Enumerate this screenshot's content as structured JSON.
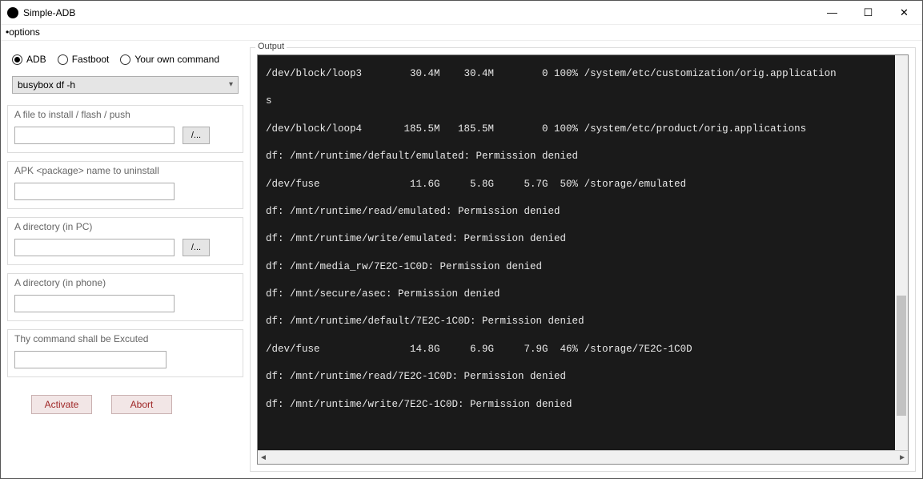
{
  "window": {
    "title": "Simple-ADB"
  },
  "menu": {
    "options": "•options"
  },
  "modes": {
    "adb": "ADB",
    "fastboot": "Fastboot",
    "own": "Your own command"
  },
  "combo": {
    "selected": "busybox df -h"
  },
  "groups": {
    "file": {
      "label": "A file to install / flash / push",
      "browse": "/..."
    },
    "apk": {
      "label": "APK <package> name to uninstall"
    },
    "dirpc": {
      "label": "A directory (in PC)",
      "browse": "/..."
    },
    "dirph": {
      "label": "A directory (in phone)"
    },
    "cmd": {
      "label": "Thy command shall be Excuted"
    }
  },
  "buttons": {
    "activate": "Activate",
    "abort": "Abort"
  },
  "output": {
    "label": "Output",
    "lines": "/dev/block/loop3        30.4M    30.4M        0 100% /system/etc/customization/orig.application\ns\n/dev/block/loop4       185.5M   185.5M        0 100% /system/etc/product/orig.applications\ndf: /mnt/runtime/default/emulated: Permission denied\n/dev/fuse               11.6G     5.8G     5.7G  50% /storage/emulated\ndf: /mnt/runtime/read/emulated: Permission denied\ndf: /mnt/runtime/write/emulated: Permission denied\ndf: /mnt/media_rw/7E2C-1C0D: Permission denied\ndf: /mnt/secure/asec: Permission denied\ndf: /mnt/runtime/default/7E2C-1C0D: Permission denied\n/dev/fuse               14.8G     6.9G     7.9G  46% /storage/7E2C-1C0D\ndf: /mnt/runtime/read/7E2C-1C0D: Permission denied\ndf: /mnt/runtime/write/7E2C-1C0D: Permission denied"
  }
}
